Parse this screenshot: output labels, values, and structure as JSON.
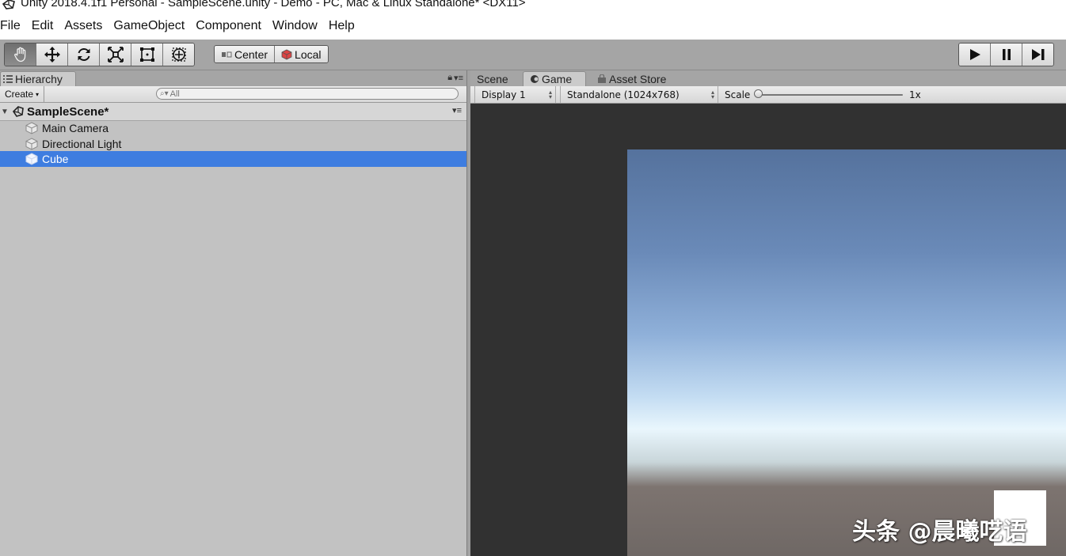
{
  "window": {
    "title": "Unity 2018.4.1f1 Personal - SampleScene.unity - Demo - PC, Mac & Linux Standalone* <DX11>"
  },
  "menu": {
    "items": [
      "File",
      "Edit",
      "Assets",
      "GameObject",
      "Component",
      "Window",
      "Help"
    ]
  },
  "toolbar": {
    "tools": [
      {
        "name": "hand-tool",
        "icon": "hand-icon",
        "active": true
      },
      {
        "name": "move-tool",
        "icon": "move-arrows-icon",
        "active": false
      },
      {
        "name": "rotate-tool",
        "icon": "rotate-icon",
        "active": false
      },
      {
        "name": "scale-tool",
        "icon": "scale-icon",
        "active": false
      },
      {
        "name": "rect-tool",
        "icon": "rect-transform-icon",
        "active": false
      },
      {
        "name": "transform-tool",
        "icon": "transform-icon",
        "active": false
      }
    ],
    "pivot_label": "Center",
    "space_label": "Local"
  },
  "hierarchy": {
    "tab_label": "Hierarchy",
    "create_label": "Create",
    "search_placeholder": "All",
    "scene_name": "SampleScene*",
    "items": [
      {
        "label": "Main Camera",
        "selected": false
      },
      {
        "label": "Directional Light",
        "selected": false
      },
      {
        "label": "Cube",
        "selected": true
      }
    ],
    "selection_color": "#3e7de0"
  },
  "game_panel": {
    "tabs": [
      {
        "label": "Scene",
        "active": false
      },
      {
        "label": "Game",
        "active": true
      },
      {
        "label": "Asset Store",
        "active": false
      }
    ],
    "display_label": "Display 1",
    "resolution_label": "Standalone (1024x768)",
    "scale_label": "Scale",
    "scale_value": "1x"
  },
  "watermark": {
    "text": "头条 @晨曦呓语"
  }
}
